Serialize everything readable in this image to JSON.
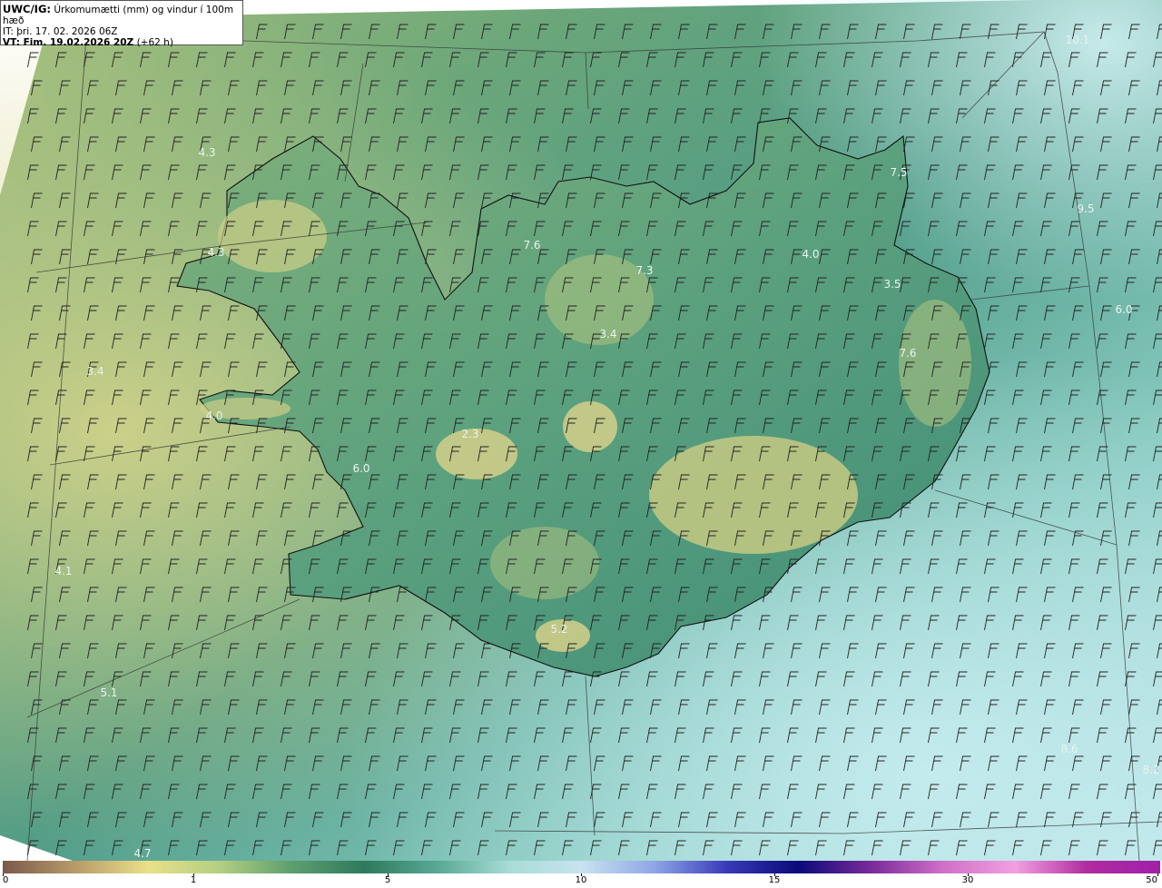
{
  "header": {
    "title_bold": "UWC/IG:",
    "title_rest": " Úrkomumætti (mm) og vindur í 100m hæð",
    "it_line": "IT: þri. 17. 02. 2026 06Z",
    "vt_bold": "VT: Fim. 19.02.2026 20Z",
    "vt_rest": " (+62 h)"
  },
  "colorbar": {
    "ticks": [
      "0",
      "1",
      "5",
      "10",
      "15",
      "30",
      "50"
    ],
    "stops": [
      "#7a5a4a",
      "#b89a6a",
      "#e8e08a",
      "#b4cf82",
      "#5c9e6e",
      "#2f7a5e",
      "#57a894",
      "#a8dcd6",
      "#c8e2f0",
      "#8fa6e6",
      "#3a3ab8",
      "#0a0a78",
      "#7a2a9a",
      "#d070c8",
      "#f0a0e0",
      "#b02aa0",
      "#a020a8"
    ]
  },
  "map_labels": [
    {
      "text": "4.3"
    },
    {
      "text": "4.3"
    },
    {
      "text": "3.4"
    },
    {
      "text": "4.0"
    },
    {
      "text": "2.3"
    },
    {
      "text": "6.0"
    },
    {
      "text": "4.1"
    },
    {
      "text": "5.1"
    },
    {
      "text": "4.7"
    },
    {
      "text": "7.6"
    },
    {
      "text": "7.3"
    },
    {
      "text": "3.4"
    },
    {
      "text": "4.0"
    },
    {
      "text": "3.5"
    },
    {
      "text": "7.5"
    },
    {
      "text": "7.6"
    },
    {
      "text": "6.0"
    },
    {
      "text": "10.1"
    },
    {
      "text": "5.2"
    },
    {
      "text": "8.6"
    },
    {
      "text": "9.5"
    },
    {
      "text": "8.2"
    }
  ]
}
